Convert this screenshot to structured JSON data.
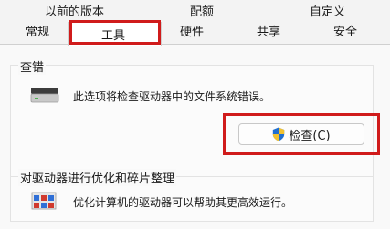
{
  "tabs_row_back": [
    "以前的版本",
    "配额",
    "自定义"
  ],
  "tabs_row_front": [
    "常规",
    "工具",
    "硬件",
    "共享",
    "安全"
  ],
  "selected_tab": "工具",
  "error_check": {
    "group_label": "查错",
    "description": "此选项将检查驱动器中的文件系统错误。",
    "button_label": "检查(C)"
  },
  "optimize": {
    "group_label": "对驱动器进行优化和碎片整理",
    "description": "优化计算机的驱动器可以帮助其更高效运行。"
  },
  "highlight_color": "#d01b1b",
  "icons": [
    "drive-icon",
    "shield-icon",
    "defrag-icon"
  ]
}
